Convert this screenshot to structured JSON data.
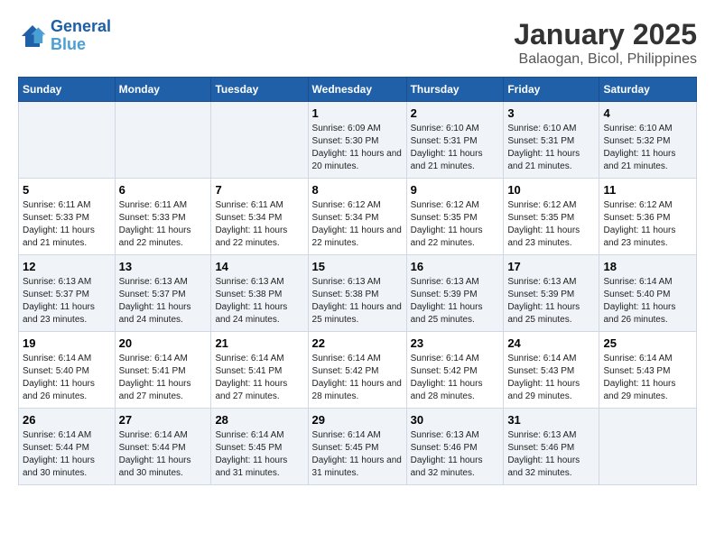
{
  "logo": {
    "line1": "General",
    "line2": "Blue"
  },
  "title": "January 2025",
  "subtitle": "Balaogan, Bicol, Philippines",
  "days_of_week": [
    "Sunday",
    "Monday",
    "Tuesday",
    "Wednesday",
    "Thursday",
    "Friday",
    "Saturday"
  ],
  "weeks": [
    [
      {
        "day": "",
        "info": ""
      },
      {
        "day": "",
        "info": ""
      },
      {
        "day": "",
        "info": ""
      },
      {
        "day": "1",
        "info": "Sunrise: 6:09 AM\nSunset: 5:30 PM\nDaylight: 11 hours and 20 minutes."
      },
      {
        "day": "2",
        "info": "Sunrise: 6:10 AM\nSunset: 5:31 PM\nDaylight: 11 hours and 21 minutes."
      },
      {
        "day": "3",
        "info": "Sunrise: 6:10 AM\nSunset: 5:31 PM\nDaylight: 11 hours and 21 minutes."
      },
      {
        "day": "4",
        "info": "Sunrise: 6:10 AM\nSunset: 5:32 PM\nDaylight: 11 hours and 21 minutes."
      }
    ],
    [
      {
        "day": "5",
        "info": "Sunrise: 6:11 AM\nSunset: 5:33 PM\nDaylight: 11 hours and 21 minutes."
      },
      {
        "day": "6",
        "info": "Sunrise: 6:11 AM\nSunset: 5:33 PM\nDaylight: 11 hours and 22 minutes."
      },
      {
        "day": "7",
        "info": "Sunrise: 6:11 AM\nSunset: 5:34 PM\nDaylight: 11 hours and 22 minutes."
      },
      {
        "day": "8",
        "info": "Sunrise: 6:12 AM\nSunset: 5:34 PM\nDaylight: 11 hours and 22 minutes."
      },
      {
        "day": "9",
        "info": "Sunrise: 6:12 AM\nSunset: 5:35 PM\nDaylight: 11 hours and 22 minutes."
      },
      {
        "day": "10",
        "info": "Sunrise: 6:12 AM\nSunset: 5:35 PM\nDaylight: 11 hours and 23 minutes."
      },
      {
        "day": "11",
        "info": "Sunrise: 6:12 AM\nSunset: 5:36 PM\nDaylight: 11 hours and 23 minutes."
      }
    ],
    [
      {
        "day": "12",
        "info": "Sunrise: 6:13 AM\nSunset: 5:37 PM\nDaylight: 11 hours and 23 minutes."
      },
      {
        "day": "13",
        "info": "Sunrise: 6:13 AM\nSunset: 5:37 PM\nDaylight: 11 hours and 24 minutes."
      },
      {
        "day": "14",
        "info": "Sunrise: 6:13 AM\nSunset: 5:38 PM\nDaylight: 11 hours and 24 minutes."
      },
      {
        "day": "15",
        "info": "Sunrise: 6:13 AM\nSunset: 5:38 PM\nDaylight: 11 hours and 25 minutes."
      },
      {
        "day": "16",
        "info": "Sunrise: 6:13 AM\nSunset: 5:39 PM\nDaylight: 11 hours and 25 minutes."
      },
      {
        "day": "17",
        "info": "Sunrise: 6:13 AM\nSunset: 5:39 PM\nDaylight: 11 hours and 25 minutes."
      },
      {
        "day": "18",
        "info": "Sunrise: 6:14 AM\nSunset: 5:40 PM\nDaylight: 11 hours and 26 minutes."
      }
    ],
    [
      {
        "day": "19",
        "info": "Sunrise: 6:14 AM\nSunset: 5:40 PM\nDaylight: 11 hours and 26 minutes."
      },
      {
        "day": "20",
        "info": "Sunrise: 6:14 AM\nSunset: 5:41 PM\nDaylight: 11 hours and 27 minutes."
      },
      {
        "day": "21",
        "info": "Sunrise: 6:14 AM\nSunset: 5:41 PM\nDaylight: 11 hours and 27 minutes."
      },
      {
        "day": "22",
        "info": "Sunrise: 6:14 AM\nSunset: 5:42 PM\nDaylight: 11 hours and 28 minutes."
      },
      {
        "day": "23",
        "info": "Sunrise: 6:14 AM\nSunset: 5:42 PM\nDaylight: 11 hours and 28 minutes."
      },
      {
        "day": "24",
        "info": "Sunrise: 6:14 AM\nSunset: 5:43 PM\nDaylight: 11 hours and 29 minutes."
      },
      {
        "day": "25",
        "info": "Sunrise: 6:14 AM\nSunset: 5:43 PM\nDaylight: 11 hours and 29 minutes."
      }
    ],
    [
      {
        "day": "26",
        "info": "Sunrise: 6:14 AM\nSunset: 5:44 PM\nDaylight: 11 hours and 30 minutes."
      },
      {
        "day": "27",
        "info": "Sunrise: 6:14 AM\nSunset: 5:44 PM\nDaylight: 11 hours and 30 minutes."
      },
      {
        "day": "28",
        "info": "Sunrise: 6:14 AM\nSunset: 5:45 PM\nDaylight: 11 hours and 31 minutes."
      },
      {
        "day": "29",
        "info": "Sunrise: 6:14 AM\nSunset: 5:45 PM\nDaylight: 11 hours and 31 minutes."
      },
      {
        "day": "30",
        "info": "Sunrise: 6:13 AM\nSunset: 5:46 PM\nDaylight: 11 hours and 32 minutes."
      },
      {
        "day": "31",
        "info": "Sunrise: 6:13 AM\nSunset: 5:46 PM\nDaylight: 11 hours and 32 minutes."
      },
      {
        "day": "",
        "info": ""
      }
    ]
  ]
}
